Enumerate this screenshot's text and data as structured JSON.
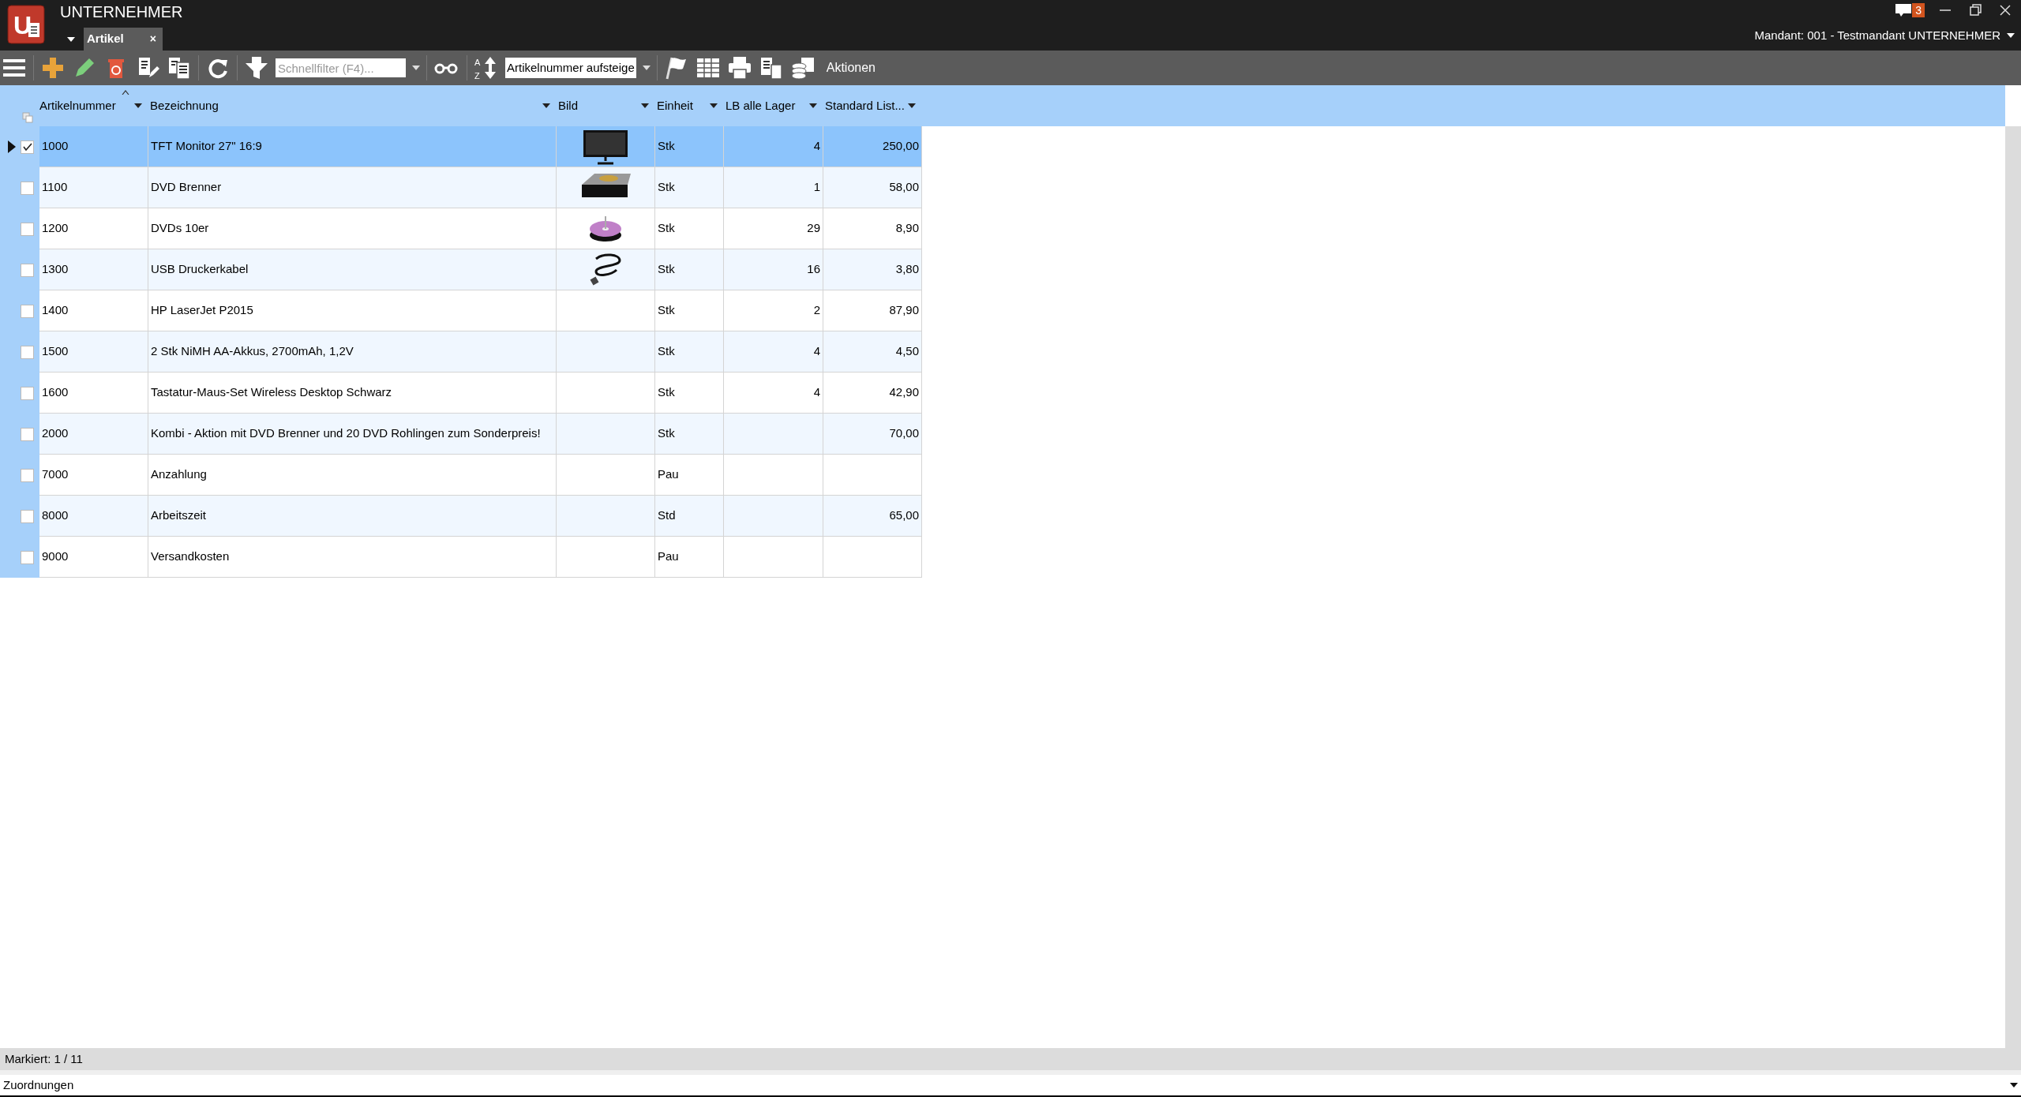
{
  "app": {
    "logo_letter": "U",
    "title": "UNTERNEHMER",
    "notification_count": "3",
    "client": "Mandant: 001 - Testmandant UNTERNEHMER"
  },
  "tabs": [
    {
      "label": "Artikel",
      "selected": true,
      "close": "×"
    }
  ],
  "toolbar": {
    "sort_icon_letters": [
      "A",
      "Z"
    ],
    "filter_placeholder": "Schnellfilter (F4)...",
    "sort_value": "Artikelnummer aufsteige",
    "actions": "Aktionen"
  },
  "table": {
    "columns": [
      {
        "label": "Artikelnummer",
        "sorted": true
      },
      {
        "label": "Bezeichnung",
        "sorted": false
      },
      {
        "label": "Bild",
        "sorted": false
      },
      {
        "label": "Einheit",
        "sorted": false
      },
      {
        "label": "LB alle Lager",
        "sorted": false
      },
      {
        "label": "Standard List...",
        "sorted": false
      }
    ],
    "rows": [
      {
        "selected": true,
        "checked": true,
        "number": "1000",
        "name": "TFT Monitor 27\" 16:9",
        "kind": "monitor",
        "unit": "Stk",
        "stock": "4",
        "price": "250,00"
      },
      {
        "selected": false,
        "checked": false,
        "number": "1100",
        "name": "DVD Brenner",
        "kind": "drive",
        "unit": "Stk",
        "stock": "1",
        "price": "58,00"
      },
      {
        "selected": false,
        "checked": false,
        "number": "1200",
        "name": "DVDs 10er",
        "kind": "discs",
        "unit": "Stk",
        "stock": "29",
        "price": "8,90"
      },
      {
        "selected": false,
        "checked": false,
        "number": "1300",
        "name": "USB Druckerkabel",
        "kind": "cable",
        "unit": "Stk",
        "stock": "16",
        "price": "3,80"
      },
      {
        "selected": false,
        "checked": false,
        "number": "1400",
        "name": "HP LaserJet P2015",
        "unit": "Stk",
        "stock": "2",
        "price": "87,90"
      },
      {
        "selected": false,
        "checked": false,
        "number": "1500",
        "name": "2 Stk NiMH AA-Akkus, 2700mAh, 1,2V",
        "unit": "Stk",
        "stock": "4",
        "price": "4,50"
      },
      {
        "selected": false,
        "checked": false,
        "number": "1600",
        "name": "Tastatur-Maus-Set Wireless Desktop Schwarz",
        "unit": "Stk",
        "stock": "4",
        "price": "42,90"
      },
      {
        "selected": false,
        "checked": false,
        "number": "2000",
        "name": "Kombi - Aktion mit DVD Brenner und 20 DVD Rohlingen zum Sonderpreis!",
        "unit": "Stk",
        "price": "70,00"
      },
      {
        "selected": false,
        "checked": false,
        "number": "7000",
        "name": "Anzahlung",
        "unit": "Pau"
      },
      {
        "selected": false,
        "checked": false,
        "number": "8000",
        "name": "Arbeitszeit",
        "unit": "Std",
        "price": "65,00"
      },
      {
        "selected": false,
        "checked": false,
        "number": "9000",
        "name": "Versandkosten",
        "unit": "Pau"
      }
    ]
  },
  "status_bar": {
    "marked": "Markiert: 1 / 11"
  },
  "bottom_panel": {
    "label": "Zuordnungen"
  }
}
